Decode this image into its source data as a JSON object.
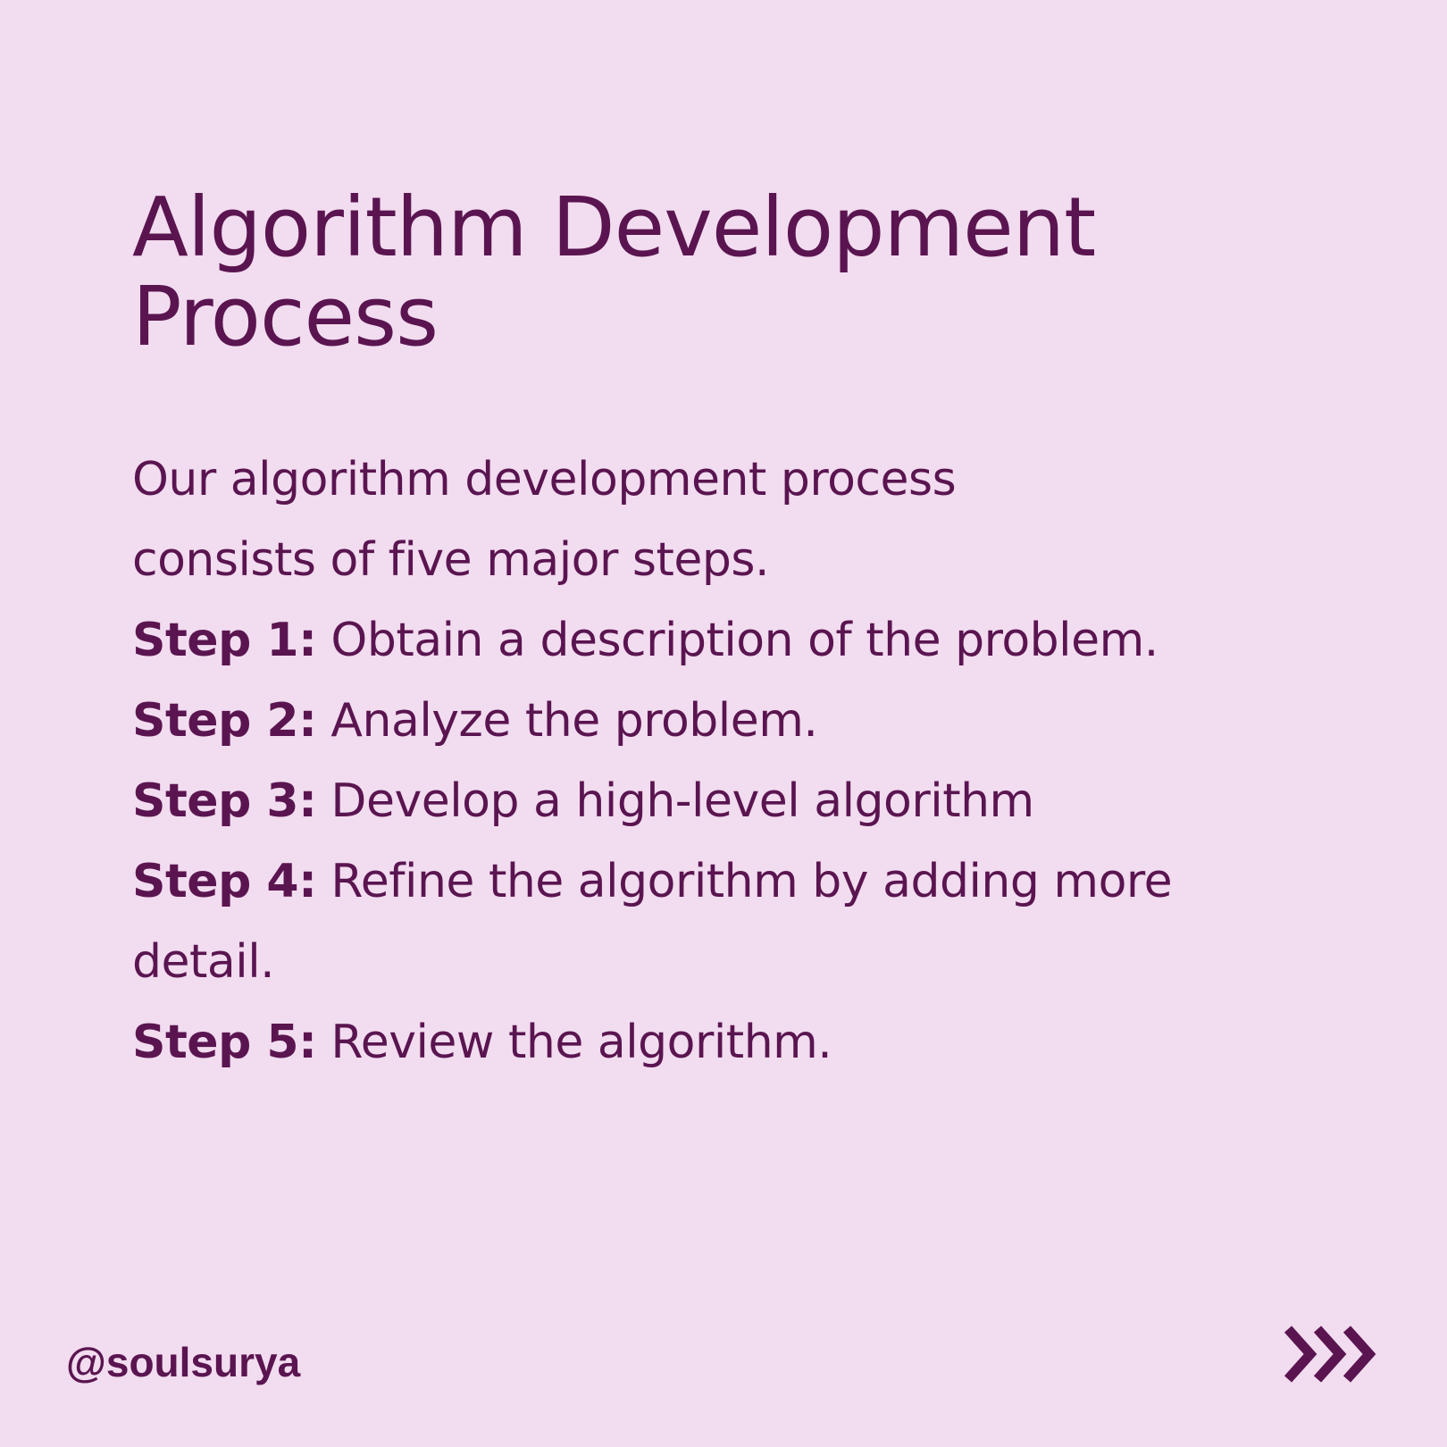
{
  "title": {
    "line1": "Algorithm Development",
    "line2": "Process"
  },
  "intro": {
    "line1": "Our algorithm development process",
    "line2": "consists of five major steps."
  },
  "steps": [
    {
      "label": "Step 1:",
      "text": " Obtain a description of the problem."
    },
    {
      "label": "Step 2:",
      "text": " Analyze the problem."
    },
    {
      "label": "Step 3:",
      "text": " Develop a high-level algorithm"
    },
    {
      "label": "Step 4:",
      "text": " Refine the algorithm by adding more",
      "text_cont": "detail."
    },
    {
      "label": "Step 5:",
      "text": " Review the algorithm."
    }
  ],
  "footer": {
    "handle": "@soulsurya",
    "next_icon": "triple-chevron-right-icon"
  },
  "colors": {
    "background": "#f2dcf0",
    "text": "#5a1550"
  }
}
